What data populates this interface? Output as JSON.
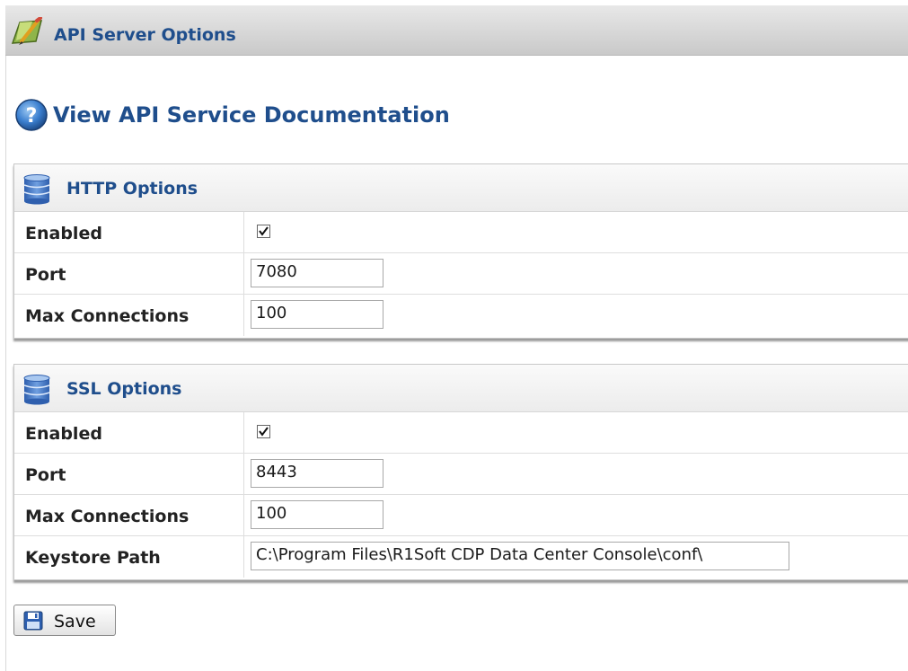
{
  "window": {
    "title": "API Server Options"
  },
  "doc_link": {
    "label": "View API Service Documentation"
  },
  "http_panel": {
    "title": "HTTP Options",
    "rows": {
      "enabled": {
        "label": "Enabled",
        "checked": true
      },
      "port": {
        "label": "Port",
        "value": "7080"
      },
      "max_connections": {
        "label": "Max Connections",
        "value": "100"
      }
    }
  },
  "ssl_panel": {
    "title": "SSL Options",
    "rows": {
      "enabled": {
        "label": "Enabled",
        "checked": true
      },
      "port": {
        "label": "Port",
        "value": "8443"
      },
      "max_connections": {
        "label": "Max Connections",
        "value": "100"
      },
      "keystore_path": {
        "label": "Keystore Path",
        "value": "C:\\Program Files\\R1Soft CDP Data Center Console\\conf\\"
      }
    }
  },
  "toolbar": {
    "save_label": "Save"
  },
  "icons": {
    "app": "pencil-app-icon",
    "help": "help-icon",
    "http_section": "database-icon",
    "ssl_section": "database-icon",
    "save": "floppy-disk-icon"
  },
  "colors": {
    "heading": "#1f4e8c",
    "titlebar": "#d4d4d4",
    "panel_header": "#f2f2f2"
  }
}
